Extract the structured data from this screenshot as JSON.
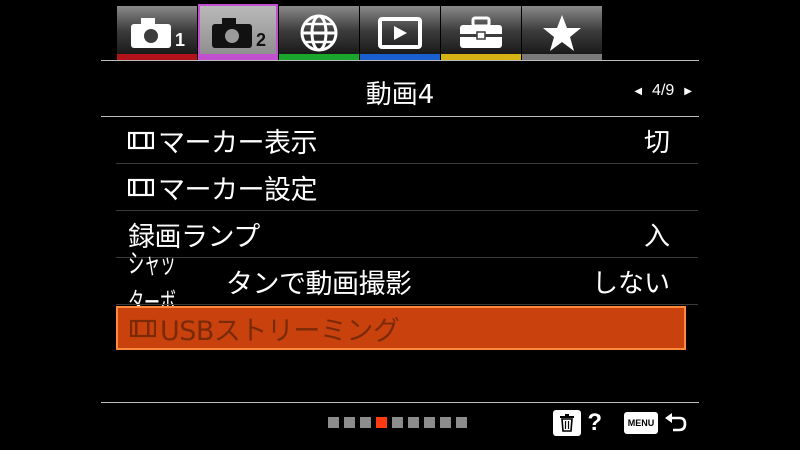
{
  "tabs": [
    {
      "icon": "camera-icon",
      "num": "1",
      "band_color": "#b3121a",
      "active": false
    },
    {
      "icon": "camera-icon",
      "num": "2",
      "band_color": "#c24fd0",
      "active": true
    },
    {
      "icon": "globe-icon",
      "num": "",
      "band_color": "#1aa52c",
      "active": false
    },
    {
      "icon": "playback-icon",
      "num": "",
      "band_color": "#1a5fd0",
      "active": false
    },
    {
      "icon": "toolbox-icon",
      "num": "",
      "band_color": "#d6b315",
      "active": false
    },
    {
      "icon": "star-icon",
      "num": "",
      "band_color": "#7a7a7a",
      "active": false
    }
  ],
  "header": {
    "title": "動画4",
    "page": "4/9"
  },
  "menu": {
    "items": [
      {
        "label": "マーカー表示",
        "value": "切",
        "movie_icon": true
      },
      {
        "label": "マーカー設定",
        "value": "",
        "movie_icon": true
      },
      {
        "label": "録画ランプ",
        "value": "入",
        "movie_icon": false
      },
      {
        "label_condensed": "シャッターボ",
        "label": "タンで動画撮影",
        "value": "しない",
        "movie_icon": false
      },
      {
        "label": "USBストリーミング",
        "value": "",
        "movie_icon": true,
        "selected": true
      }
    ]
  },
  "footer": {
    "page_dots": 9,
    "active_dot": 4,
    "help": "?",
    "menu_label": "MENU"
  },
  "colors": {
    "selected_bg": "#c9420e",
    "selected_border": "#ff8a3c",
    "active_dot": "#ff3b12"
  }
}
